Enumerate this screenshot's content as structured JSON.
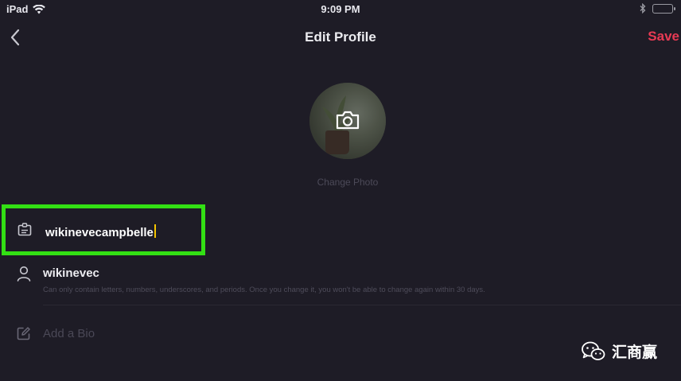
{
  "status_bar": {
    "device": "iPad",
    "time": "9:09 PM"
  },
  "nav": {
    "title": "Edit Profile",
    "save_label": "Save"
  },
  "profile": {
    "change_photo_label": "Change Photo"
  },
  "name_field": {
    "value": "wikinevecampbelle"
  },
  "username": {
    "value": "wikinevec",
    "hint": "Can only contain letters, numbers, underscores, and periods. Once you change it, you won't be able to change again within 30 days."
  },
  "bio": {
    "placeholder": "Add a Bio"
  },
  "watermark": {
    "text": "汇商赢"
  },
  "colors": {
    "background": "#1e1c26",
    "save_accent": "#e83a54",
    "highlight_box": "#33e014",
    "text_cursor": "#f5c400"
  }
}
